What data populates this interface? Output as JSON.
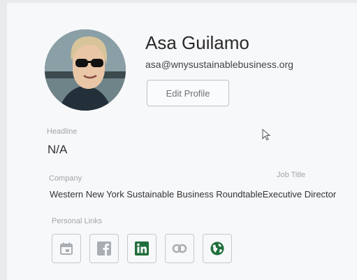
{
  "profile": {
    "name": "Asa Guilamo",
    "email": "asa@wnysustainablebusiness.org",
    "edit_label": "Edit Profile"
  },
  "headline": {
    "label": "Headline",
    "value": "N/A"
  },
  "company": {
    "label": "Company",
    "value": "Western New York Sustainable Business Roundtable"
  },
  "job_title": {
    "label": "Job Title",
    "value": "Executive Director"
  },
  "personal_links": {
    "label": "Personal Links",
    "items": [
      {
        "icon": "calendar-icon",
        "active": false
      },
      {
        "icon": "facebook-icon",
        "active": false
      },
      {
        "icon": "linkedin-icon",
        "active": true
      },
      {
        "icon": "link-icon",
        "active": false
      },
      {
        "icon": "globe-icon",
        "active": true
      }
    ]
  },
  "colors": {
    "active_icon": "#1f6e3a",
    "inactive_icon": "#a9aeb2"
  }
}
